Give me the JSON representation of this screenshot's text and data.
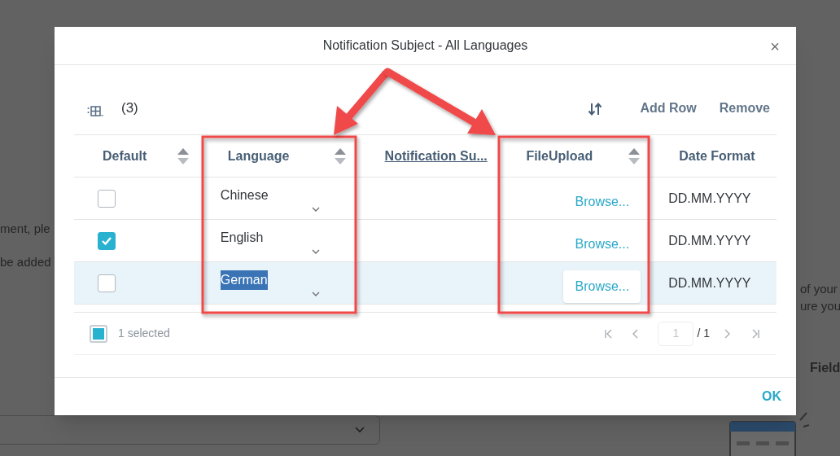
{
  "background": {
    "left_texts": [
      "ment, ple",
      "be added"
    ],
    "right_texts": [
      "of your",
      "ure you"
    ],
    "field_label": "Field"
  },
  "dialog": {
    "title": "Notification Subject - All Languages",
    "close": "×",
    "toolbar": {
      "count": "(3)",
      "buttons": [
        "Add Row",
        "Remove"
      ]
    },
    "table": {
      "columns": [
        {
          "label": "Default",
          "sortable": true,
          "underlined": false
        },
        {
          "label": "Language",
          "sortable": true,
          "underlined": false
        },
        {
          "label": "Notification Su...",
          "sortable": false,
          "underlined": true
        },
        {
          "label": "FileUpload",
          "sortable": true,
          "underlined": false
        },
        {
          "label": "Date Format",
          "sortable": false,
          "underlined": false
        }
      ],
      "rows": [
        {
          "default_checked": false,
          "language": "Chinese",
          "text_selected": false,
          "file_button": "Browse...",
          "hovered": false,
          "date_format": "DD.MM.YYYY",
          "selected": false
        },
        {
          "default_checked": true,
          "language": "English",
          "text_selected": false,
          "file_button": "Browse...",
          "hovered": false,
          "date_format": "DD.MM.YYYY",
          "selected": false
        },
        {
          "default_checked": false,
          "language": "German",
          "text_selected": true,
          "file_button": "Browse...",
          "hovered": true,
          "date_format": "DD.MM.YYYY",
          "selected": true
        }
      ]
    },
    "footer": {
      "selection": "1 selected",
      "partial": true,
      "page": "1",
      "total": "/ 1"
    },
    "ok": "OK"
  }
}
